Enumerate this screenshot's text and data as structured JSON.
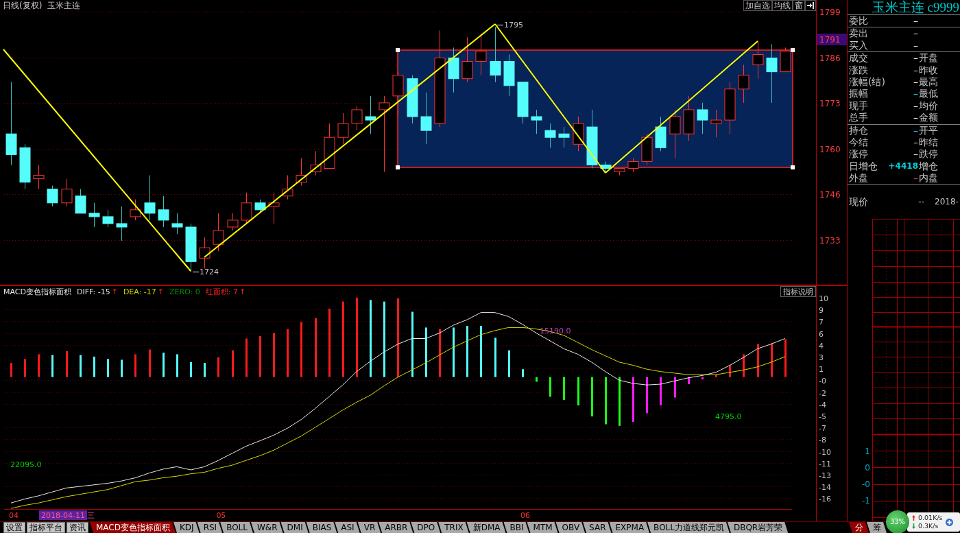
{
  "chart_header": {
    "period": "日线(复权)",
    "symbol": "玉米主连",
    "buttons": [
      "加自选",
      "均线",
      "窗"
    ]
  },
  "price_chart": {
    "current_price": "1791",
    "annotations": [
      {
        "kind": "low",
        "text": "1724"
      },
      {
        "kind": "high",
        "text": "1795"
      }
    ],
    "chart_data": {
      "type": "candlestick",
      "grid": true,
      "categories": [
        null,
        null,
        null,
        null,
        null,
        null,
        null,
        null,
        null,
        null,
        null,
        null,
        null,
        null,
        null,
        null,
        null,
        null,
        null,
        null,
        null,
        null,
        null,
        null,
        null,
        null,
        null,
        null,
        null,
        null,
        null,
        null,
        null,
        null,
        null,
        null,
        null,
        null,
        null,
        null,
        null,
        null,
        null,
        null,
        null,
        null,
        null,
        null,
        null,
        null,
        null,
        null,
        null,
        null,
        null,
        null,
        null
      ],
      "ylim": [
        1720.3,
        1802.8
      ],
      "yticks": [
        {
          "value": 1799.45,
          "label": "1799"
        },
        {
          "value": 1786.2,
          "label": "1786"
        },
        {
          "value": 1772.95,
          "label": "1773"
        },
        {
          "value": 1759.7,
          "label": "1760"
        },
        {
          "value": 1746.45,
          "label": "1746"
        },
        {
          "value": 1733.2,
          "label": "1733"
        }
      ],
      "ohlc": [
        [
          1764,
          1779,
          1755,
          1758
        ],
        [
          1760,
          1761,
          1748,
          1750
        ],
        [
          1751,
          1755,
          1748,
          1752
        ],
        [
          1748,
          1749,
          1743,
          1744
        ],
        [
          1744,
          1751,
          1743,
          1748
        ],
        [
          1746,
          1748,
          1741,
          1741
        ],
        [
          1741,
          1744,
          1737,
          1740
        ],
        [
          1740,
          1742,
          1737,
          1738
        ],
        [
          1738,
          1743,
          1733,
          1737
        ],
        [
          1740,
          1745,
          1739,
          1742
        ],
        [
          1744,
          1752,
          1739,
          1741
        ],
        [
          1742,
          1746,
          1737,
          1739
        ],
        [
          1738,
          1741,
          1735,
          1737
        ],
        [
          1737,
          1738,
          1724,
          1727
        ],
        [
          1728,
          1734,
          1725,
          1731
        ],
        [
          1732,
          1741,
          1730,
          1736
        ],
        [
          1737,
          1741,
          1736,
          1739
        ],
        [
          1739,
          1747,
          1738,
          1744
        ],
        [
          1744,
          1745,
          1741,
          1742
        ],
        [
          1743,
          1747,
          1738,
          1744
        ],
        [
          1746,
          1752,
          1745,
          1748
        ],
        [
          1750,
          1757,
          1749,
          1752
        ],
        [
          1753,
          1759,
          1752,
          1755
        ],
        [
          1754,
          1767,
          1754,
          1763
        ],
        [
          1763,
          1770,
          1761,
          1767
        ],
        [
          1767,
          1772,
          1765,
          1771
        ],
        [
          1769,
          1775,
          1764,
          1768
        ],
        [
          1771,
          1775,
          1753,
          1773
        ],
        [
          1775,
          1782,
          1769,
          1781
        ],
        [
          1780,
          1781,
          1767,
          1769
        ],
        [
          1769,
          1776,
          1761,
          1765
        ],
        [
          1767,
          1794,
          1766,
          1786
        ],
        [
          1786,
          1789,
          1776,
          1780
        ],
        [
          1780,
          1792,
          1779,
          1785
        ],
        [
          1785,
          1793,
          1781,
          1788
        ],
        [
          1785,
          1795,
          1779,
          1781
        ],
        [
          1785,
          1787,
          1775,
          1778
        ],
        [
          1779,
          1779,
          1767,
          1769
        ],
        [
          1769,
          1771,
          1764,
          1768
        ],
        [
          1765,
          1767,
          1760,
          1763
        ],
        [
          1764,
          1766,
          1760,
          1763
        ],
        [
          1761,
          1769,
          1759,
          1767
        ],
        [
          1766,
          1771,
          1754,
          1755
        ],
        [
          1755,
          1756,
          1753,
          1754
        ],
        [
          1753,
          1754,
          1752,
          1754
        ],
        [
          1754,
          1757,
          1753,
          1756
        ],
        [
          1756,
          1764,
          1755,
          1763
        ],
        [
          1766,
          1769,
          1759,
          1760
        ],
        [
          1764,
          1771,
          1757,
          1769
        ],
        [
          1764,
          1775,
          1762,
          1771
        ],
        [
          1771,
          1773,
          1764,
          1768
        ],
        [
          1767,
          1771,
          1763,
          1768
        ],
        [
          1768,
          1779,
          1764,
          1777
        ],
        [
          1777,
          1784,
          1773,
          1781
        ],
        [
          1784,
          1791,
          1780,
          1787
        ],
        [
          1786,
          1790,
          1773,
          1782
        ],
        [
          1782,
          1789,
          1782,
          1788
        ]
      ]
    }
  },
  "macd": {
    "title": "MACD变色指标面积",
    "indicators": [
      {
        "label": "DIFF: -15",
        "color": "#e0e0e0",
        "arrow": "↑"
      },
      {
        "label": "DEA: -17",
        "color": "#d0d000",
        "arrow": "↑"
      },
      {
        "label": "ZERO: 0",
        "color": "#009000"
      },
      {
        "label": "红面积: 7",
        "color": "#ff2020",
        "arrow": "↑"
      }
    ],
    "help_button": "指标说明",
    "chart_data": {
      "type": "bar",
      "grid": true,
      "categories": [
        "04",
        null,
        null,
        null,
        null,
        null,
        null,
        null,
        null,
        null,
        null,
        null,
        null,
        null,
        null,
        "05",
        null,
        null,
        null,
        null,
        null,
        null,
        null,
        null,
        null,
        null,
        null,
        null,
        null,
        null,
        null,
        null,
        null,
        null,
        null,
        null,
        null,
        "06",
        null,
        null,
        null,
        null,
        null,
        null,
        null,
        null,
        null,
        null,
        null,
        null,
        null,
        null,
        null,
        null,
        null,
        null,
        null
      ],
      "ylim": [
        -16.77,
        11.57
      ],
      "yticks": [
        {
          "value": 10,
          "label": "10"
        },
        {
          "value": 8.5,
          "label": "9"
        },
        {
          "value": 7,
          "label": "7"
        },
        {
          "value": 5.5,
          "label": "6"
        },
        {
          "value": 4,
          "label": "4"
        },
        {
          "value": 2.5,
          "label": "3"
        },
        {
          "value": 1,
          "label": "1"
        },
        {
          "value": -0.5,
          "label": "-0"
        },
        {
          "value": -2,
          "label": "-2"
        },
        {
          "value": -3.5,
          "label": "-4"
        },
        {
          "value": -5,
          "label": "-5"
        },
        {
          "value": -6.5,
          "label": "-7"
        },
        {
          "value": -8,
          "label": "-8"
        },
        {
          "value": -9.5,
          "label": "-10"
        },
        {
          "value": -11,
          "label": "-11"
        },
        {
          "value": -12.5,
          "label": "-13"
        },
        {
          "value": -14,
          "label": "-14"
        },
        {
          "value": -15.5,
          "label": "-16"
        }
      ],
      "series": [
        {
          "color": "#ff1a1a",
          "values": [
            1.8,
            2.3,
            2.9,
            null,
            3.3,
            null,
            null,
            null,
            null,
            2.9,
            3.5,
            null,
            null,
            null,
            null,
            2.5,
            3.4,
            4.9,
            5.2,
            5.6,
            6.1,
            7.0,
            7.5,
            8.7,
            9.6,
            10.1,
            null,
            null,
            10.0,
            null,
            null,
            6.1,
            null,
            null,
            null,
            null,
            null,
            null,
            null,
            null,
            null,
            null,
            null,
            null,
            null,
            null,
            null,
            null,
            null,
            null,
            null,
            0.3,
            1.5,
            2.9,
            4.2,
            4.3,
            4.8
          ]
        },
        {
          "color": "#54fcfc",
          "values": [
            null,
            null,
            null,
            2.8,
            null,
            2.8,
            2.6,
            2.3,
            2.2,
            null,
            null,
            3.1,
            2.9,
            1.9,
            1.8,
            null,
            null,
            null,
            null,
            null,
            null,
            null,
            null,
            null,
            null,
            null,
            9.8,
            9.6,
            null,
            8.3,
            6.3,
            null,
            6.3,
            6.5,
            6.5,
            5.0,
            3.4,
            1.0,
            null,
            null,
            null,
            null,
            null,
            null,
            null,
            null,
            null,
            null,
            null,
            null,
            null,
            null,
            null,
            null,
            null,
            null,
            null
          ]
        },
        {
          "color": "#1aff1a",
          "values": [
            null,
            null,
            null,
            null,
            null,
            null,
            null,
            null,
            null,
            null,
            null,
            null,
            null,
            null,
            null,
            null,
            null,
            null,
            null,
            null,
            null,
            null,
            null,
            null,
            null,
            null,
            null,
            null,
            null,
            null,
            null,
            null,
            null,
            null,
            null,
            null,
            null,
            null,
            -0.6,
            -2.5,
            -2.9,
            -3.6,
            -5.0,
            -6.0,
            -6.2,
            null,
            null,
            null,
            null,
            null,
            null,
            null,
            null,
            null,
            null,
            null,
            null
          ]
        },
        {
          "color": "#ff1aff",
          "values": [
            null,
            null,
            null,
            null,
            null,
            null,
            null,
            null,
            null,
            null,
            null,
            null,
            null,
            null,
            null,
            null,
            null,
            null,
            null,
            null,
            null,
            null,
            null,
            null,
            null,
            null,
            null,
            null,
            null,
            null,
            null,
            null,
            null,
            null,
            null,
            null,
            null,
            null,
            null,
            null,
            null,
            null,
            null,
            null,
            null,
            -5.7,
            -4.6,
            -3.6,
            -2.6,
            -0.9,
            -0.3,
            null,
            null,
            null,
            null,
            null,
            null
          ]
        },
        {
          "type": "line",
          "color": "#e8e8e8",
          "values": [
            -16.0,
            -15.5,
            -15.1,
            -14.6,
            -14.1,
            -13.9,
            -13.7,
            -13.5,
            -13.2,
            -12.8,
            -12.2,
            -11.7,
            -11.4,
            -11.8,
            -11.4,
            -10.6,
            -9.7,
            -8.8,
            -8.1,
            -7.4,
            -6.5,
            -5.4,
            -4.0,
            -2.5,
            -1.0,
            0.7,
            2.0,
            3.2,
            4.2,
            4.9,
            4.9,
            5.6,
            6.6,
            7.3,
            8.2,
            8.2,
            7.7,
            6.7,
            5.6,
            4.6,
            3.6,
            2.9,
            1.9,
            0.7,
            -0.4,
            -0.8,
            -1.0,
            -0.9,
            -0.5,
            -0.1,
            0.2,
            0.6,
            1.5,
            2.5,
            3.6,
            4.2,
            4.9
          ]
        },
        {
          "type": "line",
          "color": "#d8d800",
          "values": [
            -16.7,
            -16.3,
            -16.0,
            -15.6,
            -15.2,
            -14.9,
            -14.6,
            -14.3,
            -13.8,
            -13.3,
            -13.1,
            -12.8,
            -12.6,
            -12.3,
            -12.1,
            -11.6,
            -11.2,
            -10.6,
            -10.0,
            -9.3,
            -8.4,
            -7.5,
            -6.4,
            -5.3,
            -4.2,
            -3.2,
            -2.3,
            -1.1,
            0.0,
            0.9,
            1.8,
            2.8,
            3.8,
            4.6,
            5.4,
            5.9,
            6.3,
            6.3,
            6.1,
            5.8,
            5.3,
            4.4,
            3.5,
            2.7,
            1.9,
            1.5,
            1.0,
            0.7,
            0.5,
            0.3,
            0.3,
            0.3,
            0.6,
            0.9,
            1.3,
            1.9,
            2.6
          ]
        }
      ]
    },
    "annotations": [
      {
        "text": "22095.0",
        "color": "#00d000"
      },
      {
        "text": "15190.0",
        "color": "#c040c0"
      },
      {
        "text": "4795.0",
        "color": "#00d000"
      }
    ]
  },
  "time_axis": {
    "cursor_date": "2018-04-11 三"
  },
  "quote_panel": {
    "title": "玉米主连 c9999",
    "sections": [
      [
        {
          "label": "委比",
          "value": "–",
          "color": "#e8e8e8"
        }
      ],
      [
        {
          "label": "卖出",
          "value": "–",
          "color": "#e8e8e8"
        },
        {
          "label": "买入",
          "value": "–",
          "color": "#e8e8e8"
        }
      ],
      [
        {
          "label": "成交",
          "value": "–",
          "color": "#e8e8e8",
          "label_2": "开盘"
        },
        {
          "label": "涨跌",
          "value": "–",
          "color": "#e8e8e8",
          "label_2": "昨收"
        },
        {
          "label": "涨幅(结)",
          "value": "–",
          "color": "#e8e8e8",
          "label_2": "最高"
        },
        {
          "label": "振幅",
          "value": "–",
          "color": "#00d0d8",
          "label_2": "最低"
        },
        {
          "label": "现手",
          "value": "–",
          "color": "#e8e8e8",
          "label_2": "均价"
        },
        {
          "label": "总手",
          "value": "–",
          "color": "#e8e8e8",
          "label_2": "金额"
        }
      ],
      [
        {
          "label": "持仓",
          "value": "–",
          "color": "#00d0d8",
          "label_2": "开平"
        },
        {
          "label": "今结",
          "value": "–",
          "color": "#e8e8e8",
          "label_2": "昨结"
        },
        {
          "label": "涨停",
          "value": "–",
          "color": "#e8e8e8",
          "label_2": "跌停"
        },
        {
          "label": "日增仓",
          "value": "+4418",
          "color": "#00d0d8",
          "label_2": "增仓"
        },
        {
          "label": "外盘",
          "value": "–",
          "color": "#ff3232",
          "label_2": "内盘"
        }
      ],
      [
        {
          "kind": "price",
          "label": "现价",
          "value": "--",
          "color": "#e8e8e8",
          "label_2": "2018-"
        }
      ]
    ]
  },
  "tick_chart": {
    "labels": [
      "1",
      "0",
      "-0",
      "-1"
    ]
  },
  "indicator_tabs": [
    {
      "label": "设置",
      "kind": "button",
      "selected": false
    },
    {
      "label": "指标平台",
      "kind": "button",
      "selected": false
    },
    {
      "label": "资讯",
      "kind": "button",
      "selected": false
    },
    {
      "label": "MACD变色指标面积",
      "kind": "tab",
      "selected": true
    },
    {
      "label": "KDJ",
      "kind": "tab",
      "selected": false
    },
    {
      "label": "RSI",
      "kind": "tab",
      "selected": false
    },
    {
      "label": "BOLL",
      "kind": "tab",
      "selected": false
    },
    {
      "label": "W&R",
      "kind": "tab",
      "selected": false
    },
    {
      "label": "DMI",
      "kind": "tab",
      "selected": false
    },
    {
      "label": "BIAS",
      "kind": "tab",
      "selected": false
    },
    {
      "label": "ASI",
      "kind": "tab",
      "selected": false
    },
    {
      "label": "VR",
      "kind": "tab",
      "selected": false
    },
    {
      "label": "ARBR",
      "kind": "tab",
      "selected": false
    },
    {
      "label": "DPO",
      "kind": "tab",
      "selected": false
    },
    {
      "label": "TRIX",
      "kind": "tab",
      "selected": false
    },
    {
      "label": "新DMA",
      "kind": "tab",
      "selected": false
    },
    {
      "label": "BBI",
      "kind": "tab",
      "selected": false
    },
    {
      "label": "MTM",
      "kind": "tab",
      "selected": false
    },
    {
      "label": "OBV",
      "kind": "tab",
      "selected": false
    },
    {
      "label": "SAR",
      "kind": "tab",
      "selected": false
    },
    {
      "label": "EXPMA",
      "kind": "tab",
      "selected": false
    },
    {
      "label": "BOLL力道线郑元凯",
      "kind": "tab",
      "selected": false
    },
    {
      "label": "DBQR岩芳荣",
      "kind": "tab",
      "selected": false
    }
  ],
  "side_tabs": [
    {
      "label": "分",
      "selected": true
    },
    {
      "label": "筹",
      "selected": false
    }
  ],
  "speed_widget": {
    "usage": "33%",
    "upload": "0.01K/s",
    "download": "0.3K/s"
  }
}
